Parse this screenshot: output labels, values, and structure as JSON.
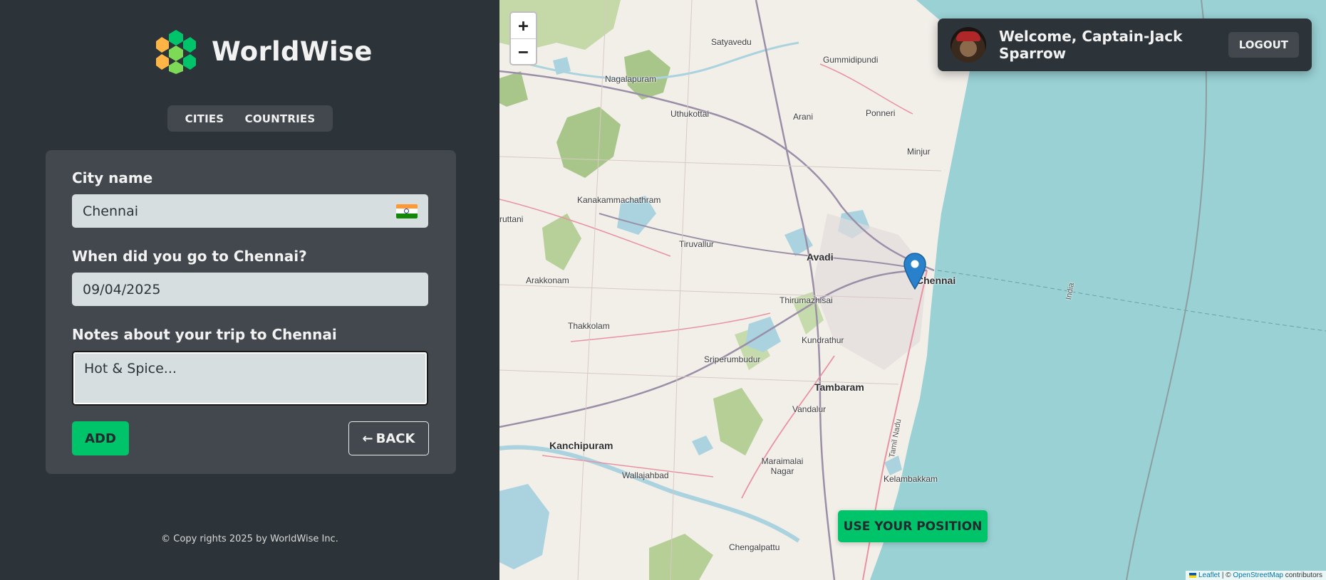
{
  "brand": {
    "name": "WorldWise"
  },
  "tabs": [
    {
      "label": "CITIES"
    },
    {
      "label": "COUNTRIES"
    }
  ],
  "form": {
    "city_label": "City name",
    "city_value": "Chennai",
    "country_flag": "india-flag-icon",
    "date_label": "When did you go to Chennai?",
    "date_value": "09/04/2025",
    "notes_label": "Notes about your trip to Chennai",
    "notes_value": "Hot & Spice...",
    "add_label": "ADD",
    "back_label": "BACK",
    "back_icon": "arrow-left-icon"
  },
  "footer": {
    "copyright": "© Copy rights 2025 by WorldWise Inc."
  },
  "map": {
    "zoom_in": "+",
    "zoom_out": "−",
    "labels": [
      "Satyavedu",
      "Gummidipundi",
      "Nagalapuram",
      "Uthukottai",
      "Arani",
      "Ponneri",
      "Minjur",
      "Kanakammachathram",
      "ruttani",
      "Tiruvallur",
      "Avadi",
      "Chennai",
      "Arakkonam",
      "Thirumazhisai",
      "Thakkolam",
      "Kundrathur",
      "Sriperumbudur",
      "Tambaram",
      "Vandalur",
      "Kanchipuram",
      "Wallajahbad",
      "Maraimalai Nagar",
      "Kelambakkam",
      "Chengalpattu",
      "Tamil Nadu",
      "India"
    ],
    "use_position_label": "USE YOUR POSITION",
    "attribution": {
      "leaflet": "Leaflet",
      "osm": "OpenStreetMap",
      "suffix": "contributors",
      "sep": "|",
      "copy": "©"
    }
  },
  "user": {
    "welcome": "Welcome, Captain-Jack Sparrow",
    "logout_label": "LOGOUT"
  },
  "colors": {
    "accent": "#00c46a",
    "sidebar": "#2d3439",
    "card": "#42484d",
    "sea": "#8ed0cd"
  }
}
